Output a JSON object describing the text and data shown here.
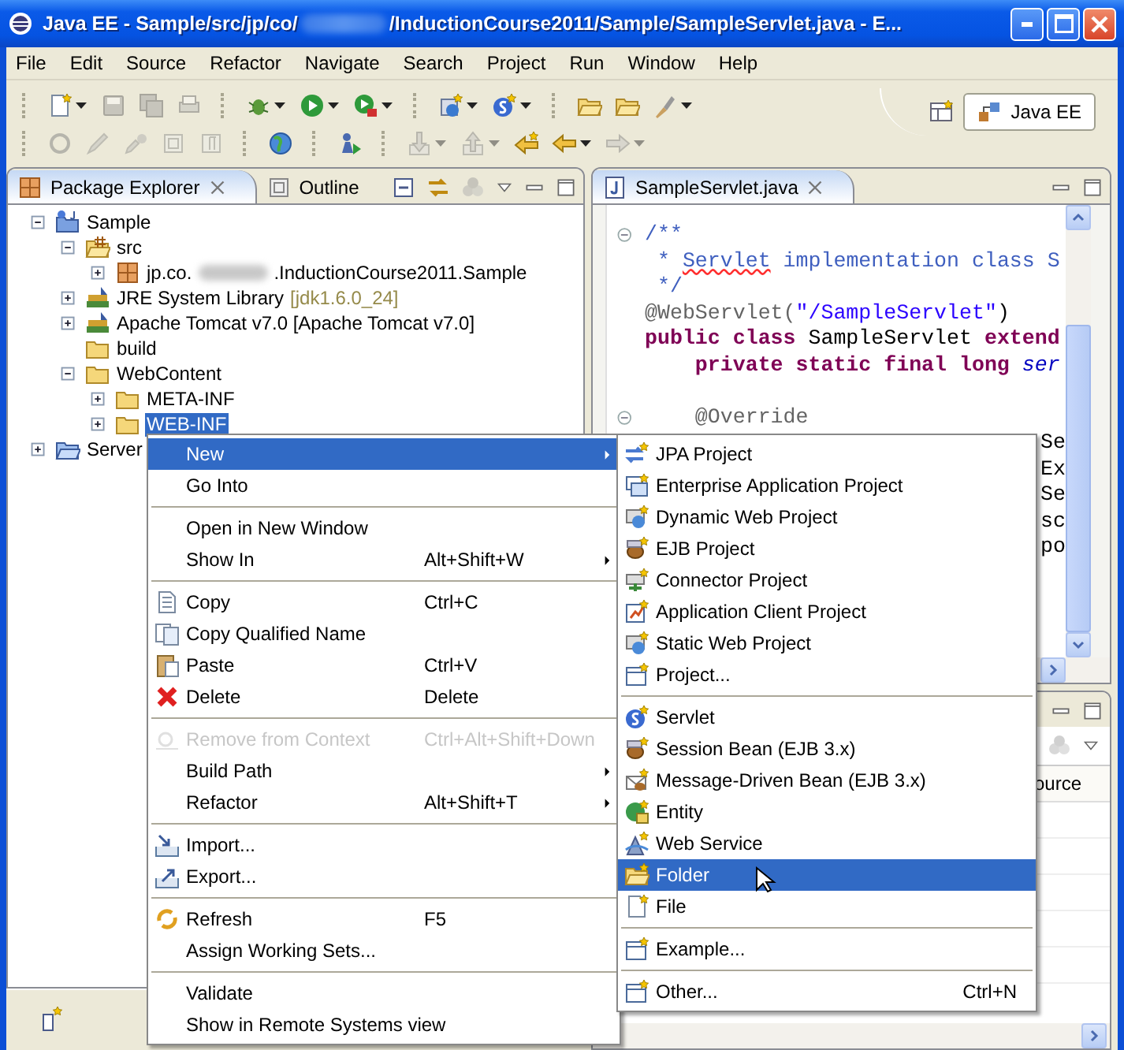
{
  "window": {
    "title_start": "Java EE - Sample/src/jp/co/",
    "title_end": "/InductionCourse2011/Sample/SampleServlet.java - E..."
  },
  "menu_bar": [
    "File",
    "Edit",
    "Source",
    "Refactor",
    "Navigate",
    "Search",
    "Project",
    "Run",
    "Window",
    "Help"
  ],
  "toolbar": {
    "rows": [
      [
        {
          "kind": "button",
          "disabled": false,
          "dropdown": true
        },
        {
          "kind": "button",
          "disabled": true,
          "dropdown": false
        },
        {
          "kind": "button",
          "disabled": true,
          "dropdown": false
        },
        {
          "kind": "button",
          "disabled": true,
          "dropdown": false
        },
        {
          "kind": "separator"
        },
        {
          "kind": "button",
          "disabled": false,
          "dropdown": true
        },
        {
          "kind": "button",
          "disabled": false,
          "dropdown": true
        },
        {
          "kind": "button",
          "disabled": false,
          "dropdown": true
        },
        {
          "kind": "separator"
        },
        {
          "kind": "button",
          "disabled": false,
          "dropdown": true
        },
        {
          "kind": "button",
          "disabled": false,
          "dropdown": true
        },
        {
          "kind": "separator"
        },
        {
          "kind": "button",
          "disabled": false,
          "dropdown": false
        },
        {
          "kind": "button",
          "disabled": false,
          "dropdown": false
        },
        {
          "kind": "button",
          "disabled": false,
          "dropdown": true
        }
      ],
      [
        {
          "kind": "button",
          "disabled": true,
          "dropdown": false
        },
        {
          "kind": "button",
          "disabled": true,
          "dropdown": false
        },
        {
          "kind": "button",
          "disabled": true,
          "dropdown": false
        },
        {
          "kind": "button",
          "disabled": true,
          "dropdown": false
        },
        {
          "kind": "button",
          "disabled": true,
          "dropdown": false
        },
        {
          "kind": "separator"
        },
        {
          "kind": "button",
          "disabled": false,
          "dropdown": false
        },
        {
          "kind": "separator"
        },
        {
          "kind": "button",
          "disabled": false,
          "dropdown": false
        },
        {
          "kind": "separator"
        },
        {
          "kind": "button",
          "disabled": true,
          "dropdown": true
        },
        {
          "kind": "button",
          "disabled": true,
          "dropdown": true
        },
        {
          "kind": "button",
          "disabled": false,
          "dropdown": false
        },
        {
          "kind": "button",
          "disabled": false,
          "dropdown": true
        },
        {
          "kind": "button",
          "disabled": true,
          "dropdown": true
        }
      ]
    ]
  },
  "perspective": {
    "label": "Java EE",
    "selected": true
  },
  "explorer": {
    "tabs": [
      {
        "label": "Package Explorer",
        "selected": true,
        "closable": true
      },
      {
        "label": "Outline",
        "selected": false,
        "closable": false
      }
    ],
    "tree": [
      {
        "kind": "project",
        "label": "Sample",
        "expanded": true,
        "leaf": false,
        "selected": false,
        "children": [
          {
            "kind": "source-folder",
            "label": "src",
            "expanded": true,
            "leaf": false,
            "selected": false,
            "children": [
              {
                "kind": "package",
                "label": "jp.co.",
                "label_after_redaction": ".InductionCourse2011.Sample",
                "expanded": false,
                "leaf": false,
                "selected": false
              }
            ]
          },
          {
            "kind": "library",
            "label": "JRE System Library",
            "decoration": "[jdk1.6.0_24]",
            "expanded": false,
            "leaf": false,
            "selected": false
          },
          {
            "kind": "library",
            "label": "Apache Tomcat v7.0 [Apache Tomcat v7.0]",
            "expanded": false,
            "leaf": false,
            "selected": false
          },
          {
            "kind": "folder",
            "label": "build",
            "expanded": false,
            "leaf": true,
            "selected": false
          },
          {
            "kind": "folder",
            "label": "WebContent",
            "expanded": true,
            "leaf": false,
            "selected": false,
            "children": [
              {
                "kind": "folder",
                "label": "META-INF",
                "expanded": false,
                "leaf": false,
                "selected": false
              },
              {
                "kind": "folder",
                "label": "WEB-INF",
                "expanded": false,
                "leaf": false,
                "selected": true
              }
            ]
          }
        ]
      },
      {
        "kind": "project-folder",
        "label": "Server",
        "expanded": false,
        "leaf": false,
        "selected": false
      }
    ]
  },
  "editor": {
    "tabs": [
      {
        "label": "SampleServlet.java",
        "selected": true
      }
    ],
    "lines": [
      {
        "kind": "code",
        "fold_marker": true,
        "segments": [
          {
            "kind": "comment",
            "text": "/**"
          }
        ]
      },
      {
        "kind": "code",
        "fold_marker": false,
        "segments": [
          {
            "kind": "comment",
            "text": " * "
          },
          {
            "kind": "misspelled",
            "text": "Servlet"
          },
          {
            "kind": "comment",
            "text": " implementation class S"
          }
        ]
      },
      {
        "kind": "code",
        "fold_marker": false,
        "segments": [
          {
            "kind": "comment",
            "text": " */"
          }
        ]
      },
      {
        "kind": "code",
        "fold_marker": false,
        "segments": [
          {
            "kind": "annotation",
            "text": "@WebServlet("
          },
          {
            "kind": "string",
            "text": "\"/SampleServlet\""
          },
          {
            "kind": "plain",
            "text": ")"
          }
        ]
      },
      {
        "kind": "code",
        "fold_marker": false,
        "segments": [
          {
            "kind": "keyword",
            "text": "public class"
          },
          {
            "kind": "plain",
            "text": " SampleServlet "
          },
          {
            "kind": "keyword",
            "text": "extend"
          }
        ]
      },
      {
        "kind": "code",
        "fold_marker": false,
        "segments": [
          {
            "kind": "keyword",
            "text": "    private static final long"
          },
          {
            "kind": "field",
            "text": " ser"
          }
        ]
      },
      {
        "kind": "blank"
      },
      {
        "kind": "code",
        "fold_marker": true,
        "segments": [
          {
            "kind": "annotation",
            "text": "    @Override"
          }
        ]
      }
    ],
    "clipped_lines": [
      "Se",
      "Ex",
      "Se",
      "sc",
      "po"
    ]
  },
  "bottom_panel": {
    "columns": [
      "ource"
    ]
  },
  "context_menu": {
    "groups": [
      [
        {
          "label": "New",
          "selected": true,
          "disabled": false,
          "submenu": true
        },
        {
          "label": "Go Into",
          "selected": false,
          "disabled": false,
          "submenu": false
        }
      ],
      [
        {
          "label": "Open in New Window",
          "selected": false,
          "disabled": false,
          "submenu": false
        },
        {
          "label": "Show In",
          "shortcut": "Alt+Shift+W",
          "selected": false,
          "disabled": false,
          "submenu": true
        }
      ],
      [
        {
          "label": "Copy",
          "shortcut": "Ctrl+C",
          "selected": false,
          "disabled": false,
          "submenu": false
        },
        {
          "label": "Copy Qualified Name",
          "selected": false,
          "disabled": false,
          "submenu": false
        },
        {
          "label": "Paste",
          "shortcut": "Ctrl+V",
          "selected": false,
          "disabled": false,
          "submenu": false
        },
        {
          "label": "Delete",
          "shortcut": "Delete",
          "selected": false,
          "disabled": false,
          "submenu": false
        }
      ],
      [
        {
          "label": "Remove from Context",
          "shortcut": "Ctrl+Alt+Shift+Down",
          "selected": false,
          "disabled": true,
          "submenu": false
        },
        {
          "label": "Build Path",
          "selected": false,
          "disabled": false,
          "submenu": true
        },
        {
          "label": "Refactor",
          "shortcut": "Alt+Shift+T",
          "selected": false,
          "disabled": false,
          "submenu": true
        }
      ],
      [
        {
          "label": "Import...",
          "selected": false,
          "disabled": false,
          "submenu": false
        },
        {
          "label": "Export...",
          "selected": false,
          "disabled": false,
          "submenu": false
        }
      ],
      [
        {
          "label": "Refresh",
          "shortcut": "F5",
          "selected": false,
          "disabled": false,
          "submenu": false
        },
        {
          "label": "Assign Working Sets...",
          "selected": false,
          "disabled": false,
          "submenu": false
        }
      ],
      [
        {
          "label": "Validate",
          "selected": false,
          "disabled": false,
          "submenu": false
        },
        {
          "label": "Show in Remote Systems view",
          "selected": false,
          "disabled": false,
          "submenu": false
        }
      ]
    ]
  },
  "new_submenu": {
    "groups": [
      [
        {
          "label": "JPA Project",
          "selected": false
        },
        {
          "label": "Enterprise Application Project",
          "selected": false
        },
        {
          "label": "Dynamic Web Project",
          "selected": false
        },
        {
          "label": "EJB Project",
          "selected": false
        },
        {
          "label": "Connector Project",
          "selected": false
        },
        {
          "label": "Application Client Project",
          "selected": false
        },
        {
          "label": "Static Web Project",
          "selected": false
        },
        {
          "label": "Project...",
          "selected": false
        }
      ],
      [
        {
          "label": "Servlet",
          "selected": false
        },
        {
          "label": "Session Bean (EJB 3.x)",
          "selected": false
        },
        {
          "label": "Message-Driven Bean (EJB 3.x)",
          "selected": false
        },
        {
          "label": "Entity",
          "selected": false
        },
        {
          "label": "Web Service",
          "selected": false
        },
        {
          "label": "Folder",
          "selected": true
        },
        {
          "label": "File",
          "selected": false
        }
      ],
      [
        {
          "label": "Example...",
          "selected": false
        }
      ],
      [
        {
          "label": "Other...",
          "shortcut": "Ctrl+N",
          "selected": false
        }
      ]
    ]
  }
}
